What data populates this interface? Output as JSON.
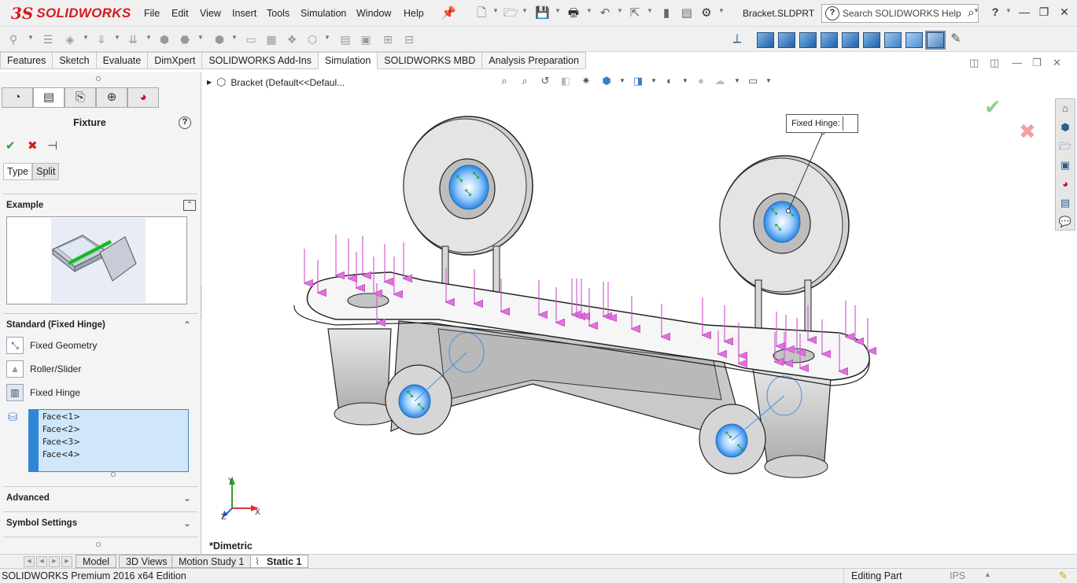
{
  "app": {
    "logo_ds": "3S",
    "logo_text": "SOLIDWORKS",
    "filename": "Bracket.SLDPRT",
    "search_placeholder": "Search SOLIDWORKS Help"
  },
  "menu": [
    "File",
    "Edit",
    "View",
    "Insert",
    "Tools",
    "Simulation",
    "Window",
    "Help"
  ],
  "command_tabs": [
    {
      "label": "Features",
      "active": false
    },
    {
      "label": "Sketch",
      "active": false
    },
    {
      "label": "Evaluate",
      "active": false
    },
    {
      "label": "DimXpert",
      "active": false
    },
    {
      "label": "SOLIDWORKS Add-Ins",
      "active": false
    },
    {
      "label": "Simulation",
      "active": true
    },
    {
      "label": "SOLIDWORKS MBD",
      "active": false
    },
    {
      "label": "Analysis Preparation",
      "active": false
    }
  ],
  "property_manager": {
    "title": "Fixture",
    "help": "?",
    "subtabs": [
      "Type",
      "Split"
    ],
    "example_label": "Example",
    "standard_label": "Standard (Fixed Hinge)",
    "options": [
      {
        "label": "Fixed Geometry",
        "icon": "fixed-geometry-icon"
      },
      {
        "label": "Roller/Slider",
        "icon": "roller-slider-icon"
      },
      {
        "label": "Fixed Hinge",
        "icon": "fixed-hinge-icon"
      }
    ],
    "faces": [
      "Face<1>",
      "Face<2>",
      "Face<3>",
      "Face<4>"
    ],
    "advanced_label": "Advanced",
    "symbol_settings_label": "Symbol Settings"
  },
  "graphics": {
    "tree_label": "Bracket  (Default<<Defaul...",
    "callout": "Fixed Hinge:",
    "view_name": "*Dimetric",
    "triad": {
      "x": "X",
      "y": "Y",
      "z": "Z"
    }
  },
  "bottom_tabs": [
    {
      "label": "Model",
      "active": false
    },
    {
      "label": "3D Views",
      "active": false
    },
    {
      "label": "Motion Study 1",
      "active": false
    },
    {
      "label": "Static 1",
      "active": true
    }
  ],
  "status": {
    "edition": "SOLIDWORKS Premium 2016 x64 Edition",
    "mode": "Editing Part",
    "units": "IPS"
  },
  "colors": {
    "brand_red": "#d71920",
    "selection_blue": "#2f85d6",
    "load_arrow": "#e070e0",
    "hinge_green": "#1aa01a"
  }
}
